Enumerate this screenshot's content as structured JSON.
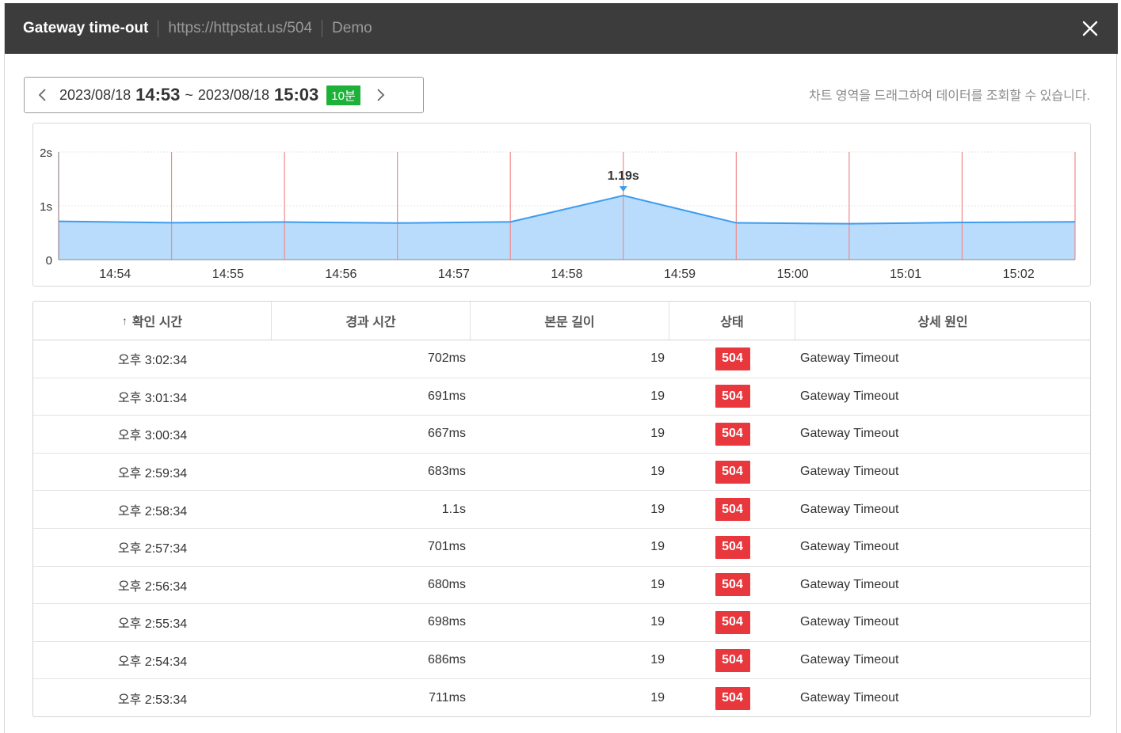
{
  "header": {
    "title": "Gateway time-out",
    "url": "https://httpstat.us/504",
    "project": "Demo"
  },
  "range": {
    "start_date": "2023/08/18",
    "start_time": "14:53",
    "tilde": "~",
    "end_date": "2023/08/18",
    "end_time": "15:03",
    "duration_badge": "10분"
  },
  "hint": "차트 영역을 드래그하여 데이터를 조회할 수 있습니다.",
  "colors": {
    "header_bg": "#3c3c3c",
    "badge_green": "#1db13a",
    "status_red": "#e8383d",
    "line_blue": "#3d9cf0",
    "area_blue": "#b9dcfc",
    "marker_red": "#f08a8a"
  },
  "chart_data": {
    "type": "area",
    "x": [
      "14:53:34",
      "14:54:34",
      "14:55:34",
      "14:56:34",
      "14:57:34",
      "14:58:34",
      "14:59:34",
      "15:00:34",
      "15:01:34",
      "15:02:34"
    ],
    "values": [
      0.711,
      0.686,
      0.698,
      0.68,
      0.701,
      1.19,
      0.683,
      0.667,
      0.691,
      0.702
    ],
    "tick_labels": [
      "14:54",
      "14:55",
      "14:56",
      "14:57",
      "14:58",
      "14:59",
      "15:00",
      "15:01",
      "15:02"
    ],
    "y_tick_labels": [
      "0",
      "1s",
      "2s"
    ],
    "ylim": [
      0,
      2
    ],
    "annotation": "1.19s",
    "grid": true
  },
  "table": {
    "sort_icon": "arrow-up-icon",
    "columns": [
      "확인 시간",
      "경과 시간",
      "본문 길이",
      "상태",
      "상세 원인"
    ],
    "rows": [
      {
        "time": "오후 3:02:34",
        "elapsed": "702ms",
        "length": "19",
        "status": "504",
        "reason": "Gateway Timeout"
      },
      {
        "time": "오후 3:01:34",
        "elapsed": "691ms",
        "length": "19",
        "status": "504",
        "reason": "Gateway Timeout"
      },
      {
        "time": "오후 3:00:34",
        "elapsed": "667ms",
        "length": "19",
        "status": "504",
        "reason": "Gateway Timeout"
      },
      {
        "time": "오후 2:59:34",
        "elapsed": "683ms",
        "length": "19",
        "status": "504",
        "reason": "Gateway Timeout"
      },
      {
        "time": "오후 2:58:34",
        "elapsed": "1.1s",
        "length": "19",
        "status": "504",
        "reason": "Gateway Timeout"
      },
      {
        "time": "오후 2:57:34",
        "elapsed": "701ms",
        "length": "19",
        "status": "504",
        "reason": "Gateway Timeout"
      },
      {
        "time": "오후 2:56:34",
        "elapsed": "680ms",
        "length": "19",
        "status": "504",
        "reason": "Gateway Timeout"
      },
      {
        "time": "오후 2:55:34",
        "elapsed": "698ms",
        "length": "19",
        "status": "504",
        "reason": "Gateway Timeout"
      },
      {
        "time": "오후 2:54:34",
        "elapsed": "686ms",
        "length": "19",
        "status": "504",
        "reason": "Gateway Timeout"
      },
      {
        "time": "오후 2:53:34",
        "elapsed": "711ms",
        "length": "19",
        "status": "504",
        "reason": "Gateway Timeout"
      }
    ]
  }
}
